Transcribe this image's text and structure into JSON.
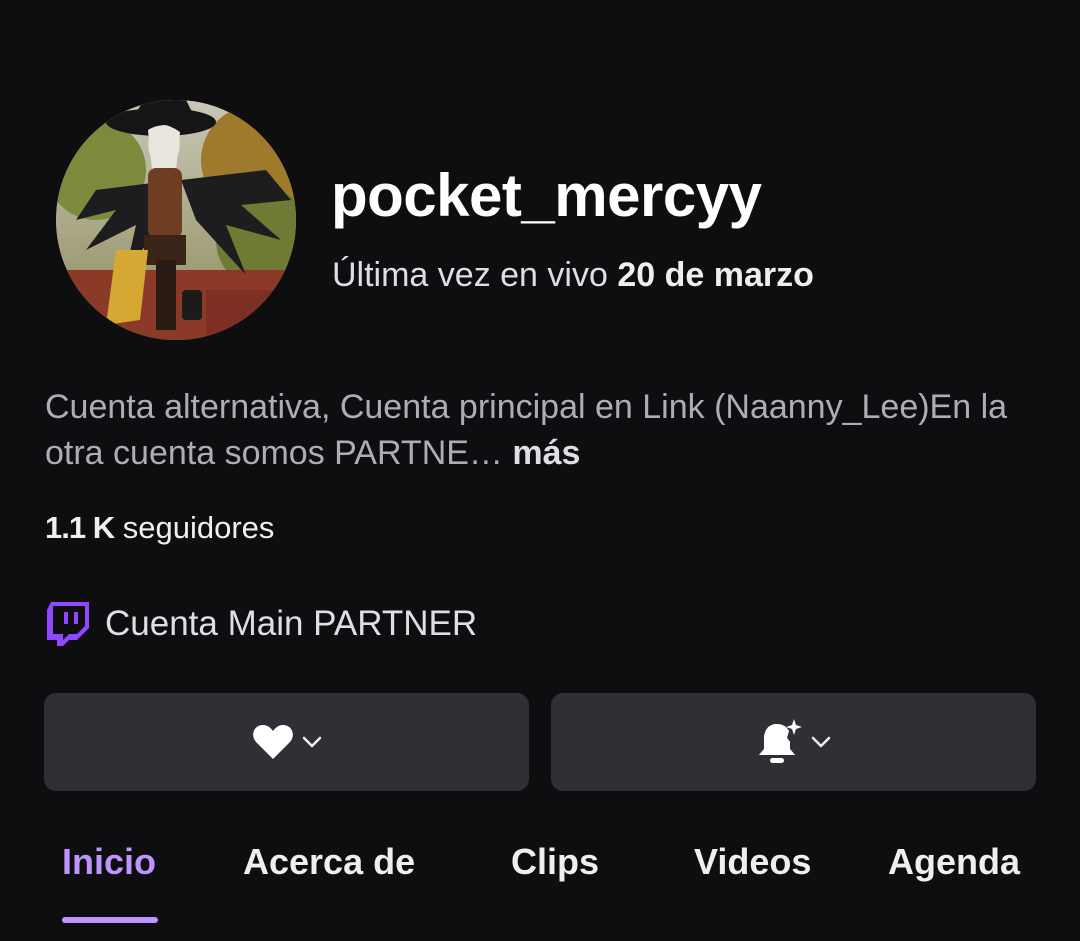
{
  "profile": {
    "username": "pocket_mercyy",
    "last_live_prefix": "Última vez en vivo",
    "last_live_date": "20 de marzo",
    "bio_text": "Cuenta alternativa, Cuenta principal en Link (Naanny_Lee)En la otra cuenta somos PARTNE…",
    "bio_more": "más",
    "followers_count": "1.1 K",
    "followers_label": "seguidores"
  },
  "team": {
    "icon": "twitch-glitch-icon",
    "name": "Cuenta Main PARTNER"
  },
  "actions": {
    "follow_icon": "heart-icon",
    "notify_icon": "bell-sparkle-icon"
  },
  "tabs": [
    {
      "label": "Inicio",
      "active": true
    },
    {
      "label": "Acerca de",
      "active": false
    },
    {
      "label": "Clips",
      "active": false
    },
    {
      "label": "Videos",
      "active": false
    },
    {
      "label": "Agenda",
      "active": false
    }
  ],
  "colors": {
    "background": "#0e0e10",
    "accent": "#bf94ff",
    "twitch_purple": "#9146ff",
    "button_bg": "#2f2f35"
  }
}
